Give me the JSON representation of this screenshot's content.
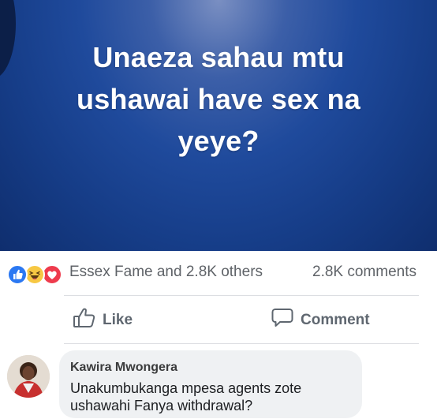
{
  "post": {
    "image_text_lines": [
      "Unaeza sahau mtu",
      "ushawai have sex na",
      "yeye?"
    ],
    "background_color": "#1f4a9c"
  },
  "reactions": {
    "icons": [
      "like-reaction-icon",
      "haha-reaction-icon",
      "love-reaction-icon"
    ],
    "names_text": "Essex Fame and 2.8K others",
    "comments_count": "2.8K comments"
  },
  "actions": {
    "like_label": "Like",
    "comment_label": "Comment"
  },
  "comment": {
    "author": "Kawira Mwongera",
    "text": "Unakumbukanga mpesa agents zote ushawahi Fanya withdrawal?"
  },
  "colors": {
    "like_blue": "#2b78f2",
    "love_red": "#ee3b4d",
    "haha_yellow": "#f7c843",
    "meta_gray": "#5f6368",
    "bubble_bg": "#eff1f3"
  }
}
